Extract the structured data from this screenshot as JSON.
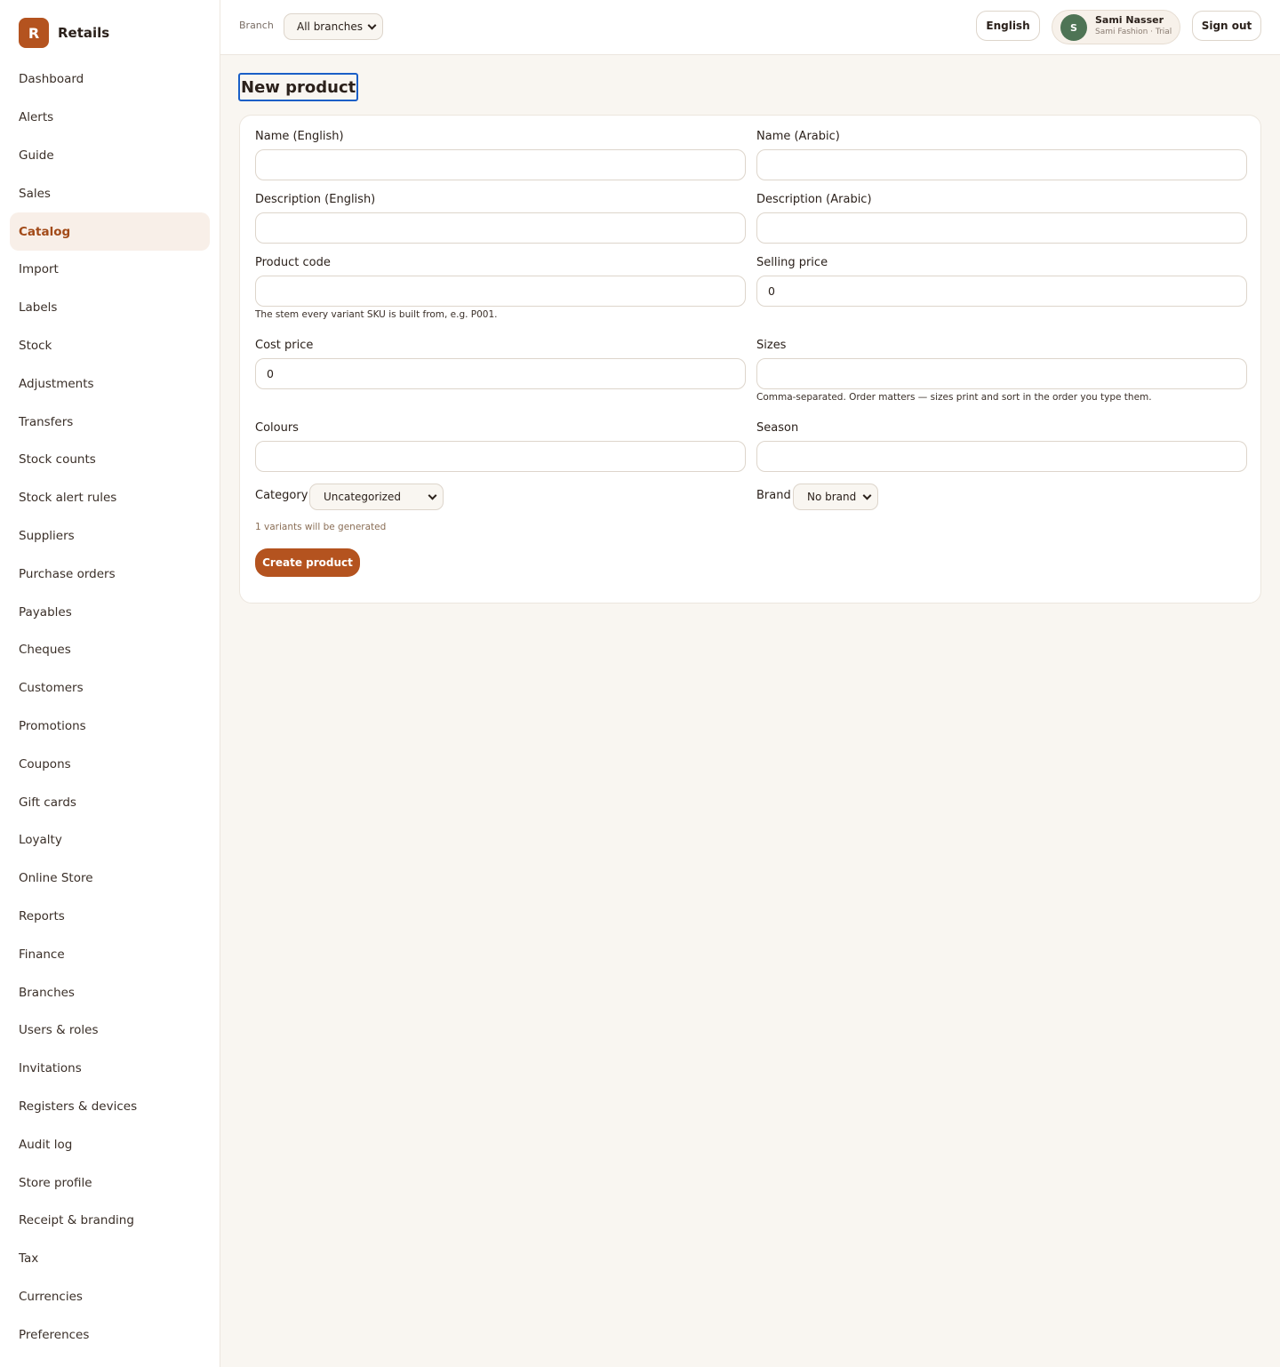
{
  "app": {
    "logo_letter": "R",
    "name": "Retails"
  },
  "sidebar": {
    "items": [
      {
        "label": "Dashboard",
        "active": false
      },
      {
        "label": "Alerts",
        "active": false
      },
      {
        "label": "Guide",
        "active": false
      },
      {
        "label": "Sales",
        "active": false
      },
      {
        "label": "Catalog",
        "active": true
      },
      {
        "label": "Import",
        "active": false
      },
      {
        "label": "Labels",
        "active": false
      },
      {
        "label": "Stock",
        "active": false
      },
      {
        "label": "Adjustments",
        "active": false
      },
      {
        "label": "Transfers",
        "active": false
      },
      {
        "label": "Stock counts",
        "active": false
      },
      {
        "label": "Stock alert rules",
        "active": false
      },
      {
        "label": "Suppliers",
        "active": false
      },
      {
        "label": "Purchase orders",
        "active": false
      },
      {
        "label": "Payables",
        "active": false
      },
      {
        "label": "Cheques",
        "active": false
      },
      {
        "label": "Customers",
        "active": false
      },
      {
        "label": "Promotions",
        "active": false
      },
      {
        "label": "Coupons",
        "active": false
      },
      {
        "label": "Gift cards",
        "active": false
      },
      {
        "label": "Loyalty",
        "active": false
      },
      {
        "label": "Online Store",
        "active": false
      },
      {
        "label": "Reports",
        "active": false
      },
      {
        "label": "Finance",
        "active": false
      },
      {
        "label": "Branches",
        "active": false
      },
      {
        "label": "Users & roles",
        "active": false
      },
      {
        "label": "Invitations",
        "active": false
      },
      {
        "label": "Registers & devices",
        "active": false
      },
      {
        "label": "Audit log",
        "active": false
      },
      {
        "label": "Store profile",
        "active": false
      },
      {
        "label": "Receipt & branding",
        "active": false
      },
      {
        "label": "Tax",
        "active": false
      },
      {
        "label": "Currencies",
        "active": false
      },
      {
        "label": "Preferences",
        "active": false
      }
    ]
  },
  "topbar": {
    "branch_label": "Branch",
    "branch_value": "All branches",
    "language": "English",
    "user": {
      "initial": "S",
      "name": "Sami Nasser",
      "subtitle": "Sami Fashion · Trial"
    },
    "sign_out": "Sign out"
  },
  "page": {
    "title": "New product"
  },
  "form": {
    "name_en_label": "Name (English)",
    "name_en_value": "",
    "name_ar_label": "Name (Arabic)",
    "name_ar_value": "",
    "desc_en_label": "Description (English)",
    "desc_en_value": "",
    "desc_ar_label": "Description (Arabic)",
    "desc_ar_value": "",
    "code_label": "Product code",
    "code_value": "",
    "code_hint": "The stem every variant SKU is built from, e.g. P001.",
    "selling_label": "Selling price",
    "selling_value": "0",
    "cost_label": "Cost price",
    "cost_value": "0",
    "sizes_label": "Sizes",
    "sizes_value": "",
    "sizes_hint": "Comma-separated. Order matters — sizes print and sort in the order you type them.",
    "colours_label": "Colours",
    "colours_value": "",
    "season_label": "Season",
    "season_value": "",
    "category_label": "Category",
    "category_value": "Uncategorized",
    "brand_label": "Brand",
    "brand_value": "No brand",
    "variants_note": "1 variants will be generated",
    "submit": "Create product"
  },
  "colors": {
    "accent": "#b4531f",
    "accent_active_bg": "#f8efe8",
    "background": "#f9f6f1",
    "avatar": "#4e7455"
  }
}
